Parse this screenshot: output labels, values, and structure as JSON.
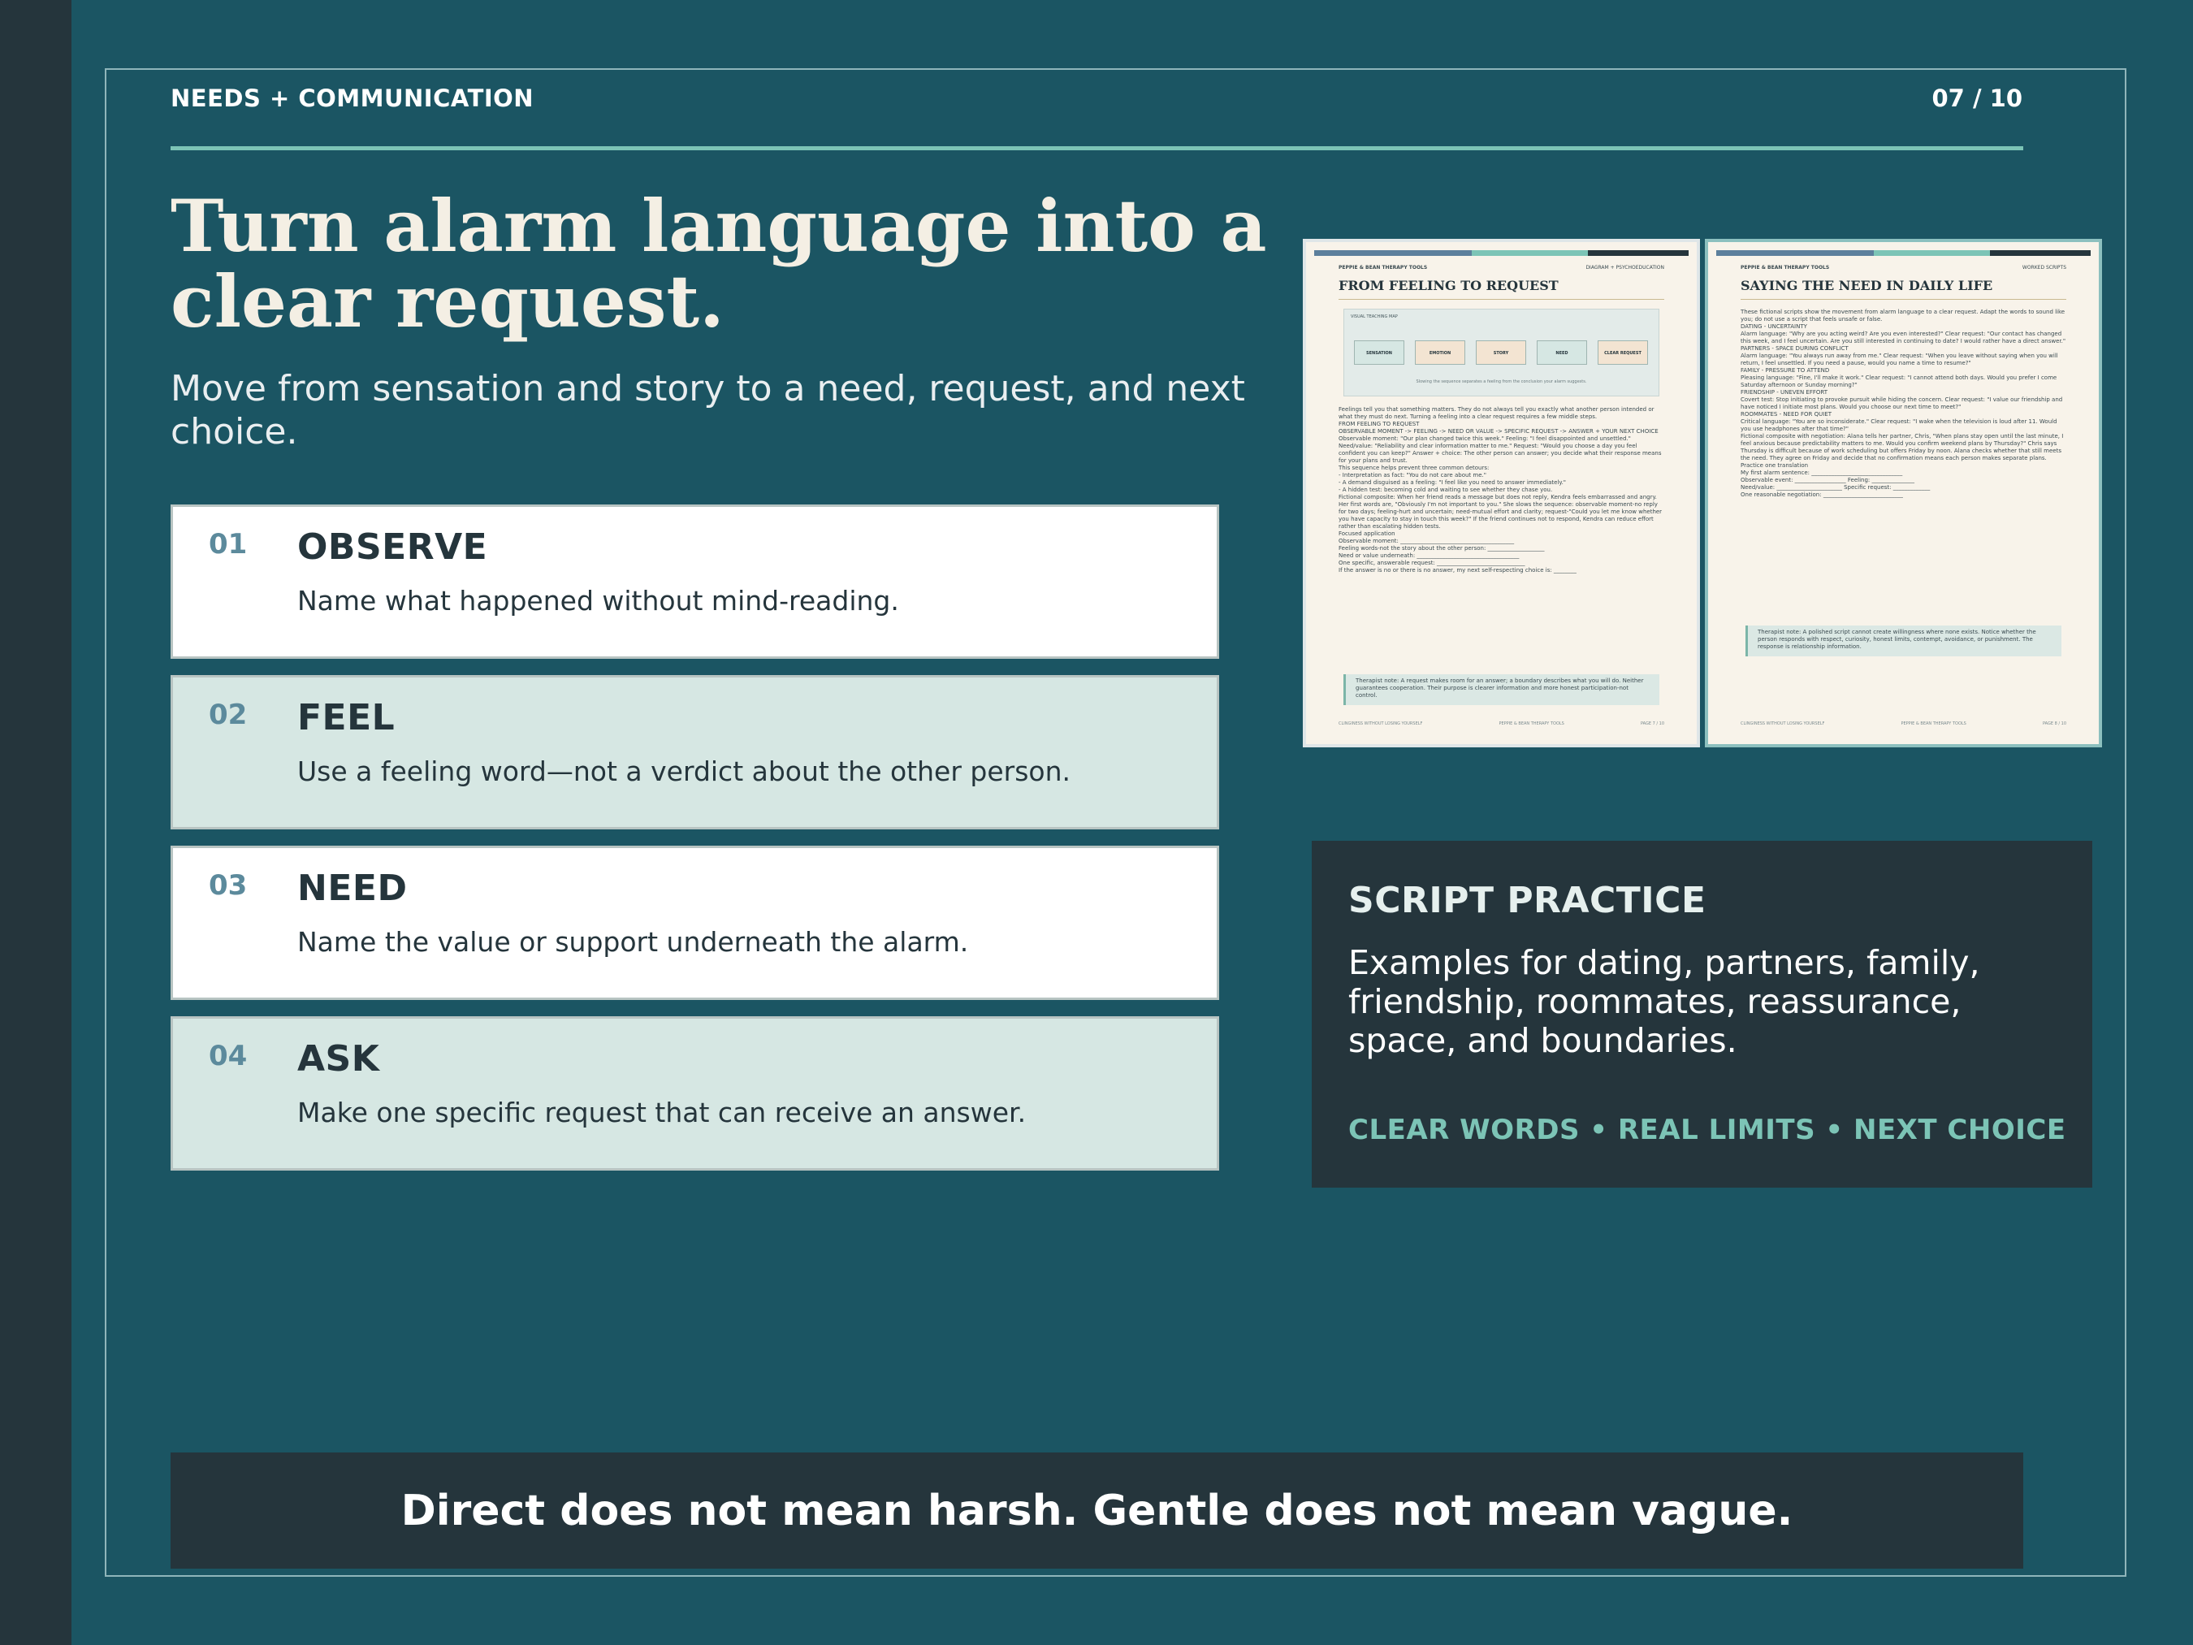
{
  "header": {
    "kicker": "NEEDS + COMMUNICATION",
    "page": "07 / 10"
  },
  "title": "Turn alarm language into a clear request.",
  "subtitle": "Move from sensation and story to a need, request, and next choice.",
  "steps": [
    {
      "num": "01",
      "head": "OBSERVE",
      "desc": "Name what happened without mind-reading."
    },
    {
      "num": "02",
      "head": "FEEL",
      "desc": "Use a feeling word—not a verdict about the other person."
    },
    {
      "num": "03",
      "head": "NEED",
      "desc": "Name the value or support underneath the alarm."
    },
    {
      "num": "04",
      "head": "ASK",
      "desc": "Make one specific request that can receive an answer."
    }
  ],
  "thumbnails": [
    {
      "brand": "PEPPIE & BEAN THERAPY TOOLS",
      "tag": "DIAGRAM + PSYCHOEDUCATION",
      "title": "FROM FEELING TO REQUEST",
      "map_label": "VISUAL TEACHING MAP",
      "nodes": [
        "SENSATION",
        "EMOTION",
        "STORY",
        "NEED",
        "CLEAR REQUEST"
      ],
      "map_caption": "Slowing the sequence separates a feeling from the conclusion your alarm suggests.",
      "body": "Feelings tell you that something matters. They do not always tell you exactly what another person intended or what they must do next. Turning a feeling into a clear request requires a few middle steps.\nFROM FEELING TO REQUEST\nOBSERVABLE MOMENT -> FEELING -> NEED OR VALUE -> SPECIFIC REQUEST -> ANSWER + YOUR NEXT CHOICE\nObservable moment: \"Our plan changed twice this week.\" Feeling: \"I feel disappointed and unsettled.\" Need/value: \"Reliability and clear information matter to me.\" Request: \"Would you choose a day you feel confident you can keep?\" Answer + choice: The other person can answer; you decide what their response means for your plans and trust.\nThis sequence helps prevent three common detours:\n- Interpretation as fact: \"You do not care about me.\"\n- A demand disguised as a feeling: \"I feel like you need to answer immediately.\"\n- A hidden test: becoming cold and waiting to see whether they chase you.\nFictional composite: When her friend reads a message but does not reply, Kendra feels embarrassed and angry. Her first words are, \"Obviously I'm not important to you.\" She slows the sequence: observable moment-no reply for two days; feeling-hurt and uncertain; need-mutual effort and clarity; request-\"Could you let me know whether you have capacity to stay in touch this week?\" If the friend continues not to respond, Kendra can reduce effort rather than escalating hidden tests.\nFocused application\nObservable moment: ________________________________________\nFeeling words-not the story about the other person: ____________________\nNeed or value underneath: ____________________________________\nOne specific, answerable request: _______________________________\nIf the answer is no or there is no answer, my next self-respecting choice is: ________",
      "note": "Therapist note: A request makes room for an answer; a boundary describes what you will do. Neither guarantees cooperation. Their purpose is clearer information and more honest participation-not control.",
      "footer": [
        "CLINGINESS WITHOUT LOSING YOURSELF",
        "PEPPIE & BEAN THERAPY TOOLS",
        "PAGE 7 / 10"
      ]
    },
    {
      "brand": "PEPPIE & BEAN THERAPY TOOLS",
      "tag": "WORKED SCRIPTS",
      "title": "SAYING THE NEED IN DAILY LIFE",
      "body": "These fictional scripts show the movement from alarm language to a clear request. Adapt the words to sound like you; do not use a script that feels unsafe or false.\nDATING - UNCERTAINTY\nAlarm language: \"Why are you acting weird? Are you even interested?\" Clear request: \"Our contact has changed this week, and I feel uncertain. Are you still interested in continuing to date? I would rather have a direct answer.\"\nPARTNERS - SPACE DURING CONFLICT\nAlarm language: \"You always run away from me.\" Clear request: \"When you leave without saying when you will return, I feel unsettled. If you need a pause, would you name a time to resume?\"\nFAMILY - PRESSURE TO ATTEND\nPleasing language: \"Fine, I'll make it work.\" Clear request: \"I cannot attend both days. Would you prefer I come Saturday afternoon or Sunday morning?\"\nFRIENDSHIP - UNEVEN EFFORT\nCovert test: Stop initiating to provoke pursuit while hiding the concern. Clear request: \"I value our friendship and have noticed I initiate most plans. Would you choose our next time to meet?\"\nROOMMATES - NEED FOR QUIET\nCritical language: \"You are so inconsiderate.\" Clear request: \"I wake when the television is loud after 11. Would you use headphones after that time?\"\nFictional composite with negotiation: Alana tells her partner, Chris, \"When plans stay open until the last minute, I feel anxious because predictability matters to me. Would you confirm weekend plans by Thursday?\" Chris says Thursday is difficult because of work scheduling but offers Friday by noon. Alana checks whether that still meets the need. They agree on Friday and decide that no confirmation means each person makes separate plans.\nPractice one translation\nMy first alarm sentence: ________________________________\nObservable event: __________________ Feeling: _______________\nNeed/value: _______________________ Specific request: _____________\nOne reasonable negotiation: ____________________________",
      "note": "Therapist note: A polished script cannot create willingness where none exists. Notice whether the person responds with respect, curiosity, honest limits, contempt, avoidance, or punishment. The response is relationship information.",
      "footer": [
        "CLINGINESS WITHOUT LOSING YOURSELF",
        "PEPPIE & BEAN THERAPY TOOLS",
        "PAGE 8 / 10"
      ]
    }
  ],
  "script_practice": {
    "heading": "SCRIPT PRACTICE",
    "description": "Examples for dating, partners, family, friendship, roommates, reassurance, space, and boundaries.",
    "tags": "CLEAR WORDS • REAL LIMITS • NEXT CHOICE"
  },
  "banner": "Direct does not mean harsh. Gentle does not mean vague.",
  "colors": {
    "background": "#1b5563",
    "dark": "#25353c",
    "accent": "#7cc4b6",
    "card_mint": "#d6e7e3",
    "number_blue": "#5c8a9c"
  }
}
